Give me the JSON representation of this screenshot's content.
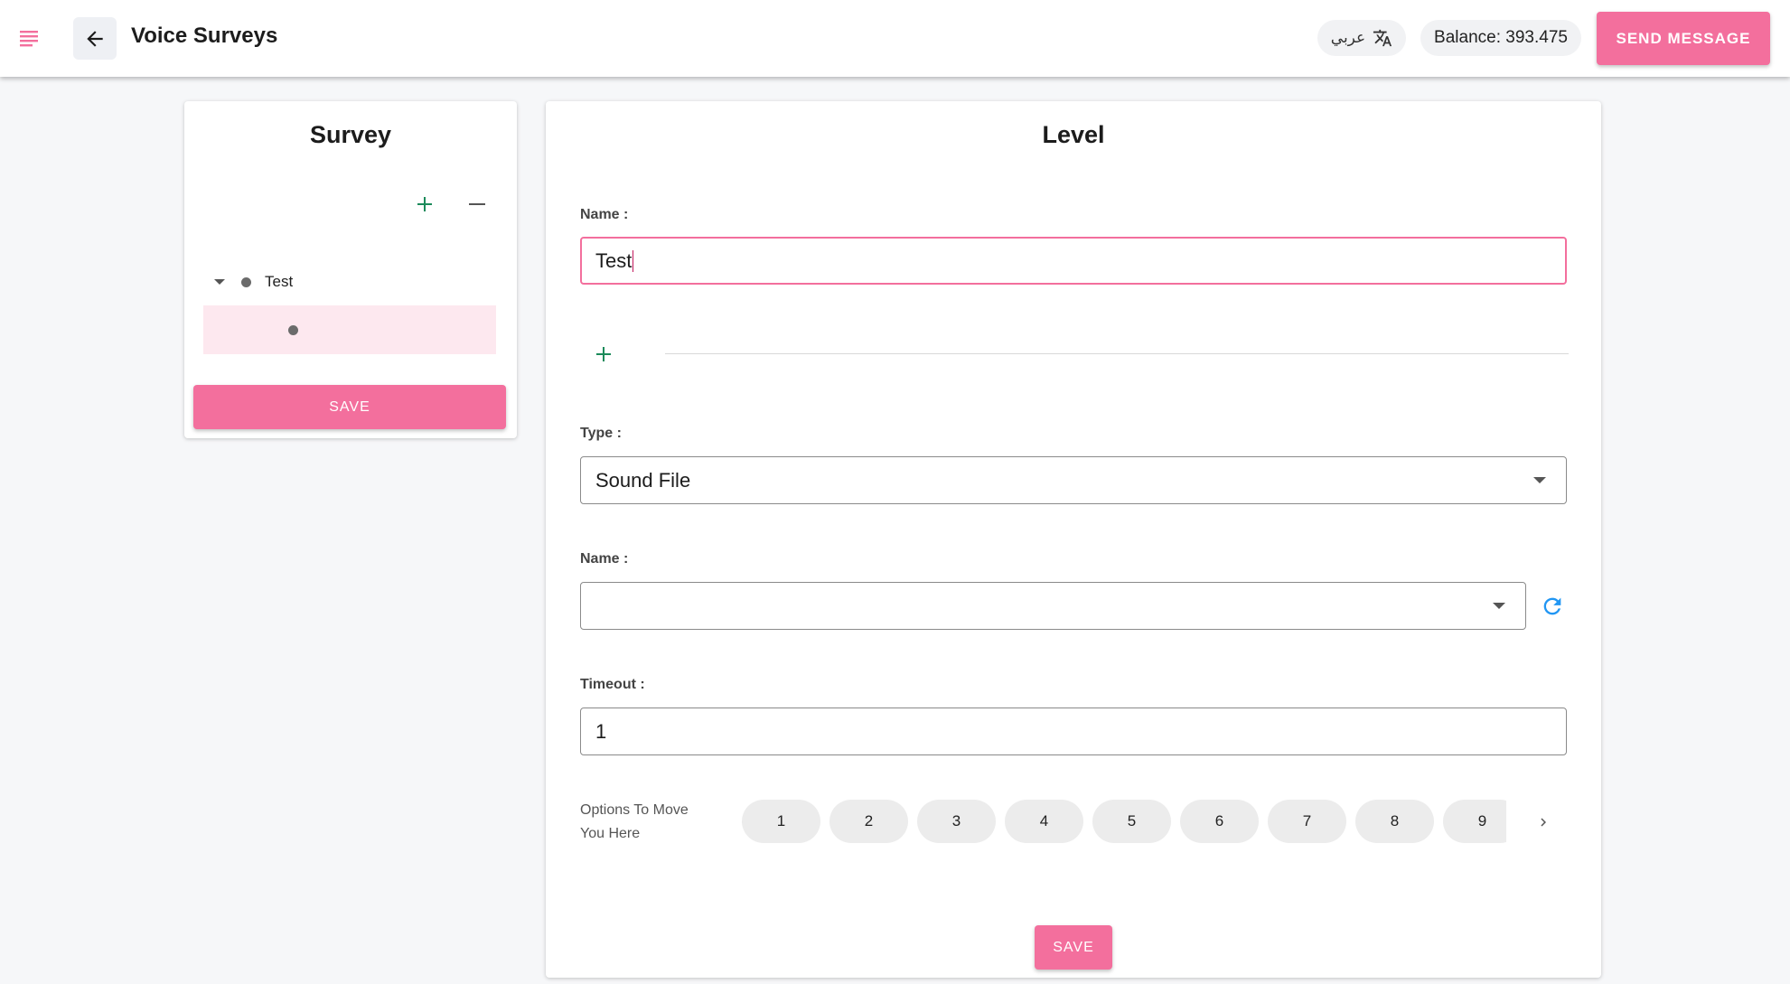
{
  "header": {
    "title": "Voice Surveys",
    "language_label": "عربي",
    "balance": "Balance: 393.475",
    "send_message_label": "SEND MESSAGE"
  },
  "survey": {
    "title": "Survey",
    "tree": [
      {
        "label": "Test",
        "expanded": true,
        "selected": false
      },
      {
        "label": "",
        "expanded": false,
        "selected": true
      }
    ],
    "save_label": "SAVE"
  },
  "level": {
    "title": "Level",
    "name_label": "Name :",
    "name_value": "Test",
    "type_label": "Type :",
    "type_value": "Sound File",
    "file_name_label": "Name :",
    "file_name_value": "",
    "timeout_label": "Timeout :",
    "timeout_value": "1",
    "options_label": "Options To Move You Here",
    "options": [
      "1",
      "2",
      "3",
      "4",
      "5",
      "6",
      "7",
      "8",
      "9"
    ],
    "save_label": "SAVE"
  },
  "colors": {
    "accent": "#f36f9d",
    "add_green": "#1b8a5a",
    "refresh_blue": "#2196f3",
    "selected_row": "#fde8ef"
  },
  "icons": [
    "menu-icon",
    "arrow-left-icon",
    "translate-icon",
    "plus-icon",
    "minus-icon",
    "caret-down-icon",
    "refresh-icon",
    "chevron-left-icon",
    "chevron-right-icon"
  ]
}
